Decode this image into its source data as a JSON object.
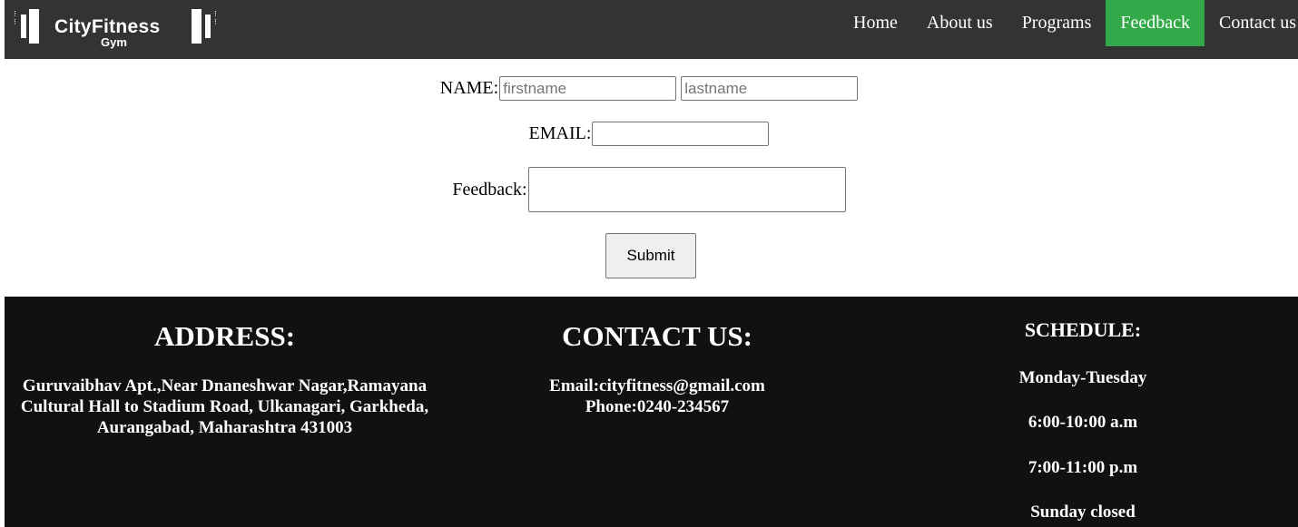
{
  "brand": {
    "name": "CityFitness",
    "tagline": "Gym"
  },
  "nav": {
    "items": [
      {
        "label": "Home"
      },
      {
        "label": "About us"
      },
      {
        "label": "Programs"
      },
      {
        "label": "Feedback",
        "active": true
      },
      {
        "label": "Contact us"
      }
    ]
  },
  "form": {
    "name_label": "NAME:",
    "firstname_placeholder": "firstname",
    "lastname_placeholder": "lastname",
    "email_label": "EMAIL:",
    "feedback_label": "Feedback:",
    "submit_label": "Submit"
  },
  "footer": {
    "address": {
      "heading": "ADDRESS:",
      "lines": [
        "Guruvaibhav Apt.,Near Dnaneshwar Nagar,Ramayana",
        "Cultural Hall to Stadium Road, Ulkanagari, Garkheda,",
        "Aurangabad, Maharashtra 431003"
      ]
    },
    "contact": {
      "heading": "CONTACT US:",
      "email": "Email:cityfitness@gmail.com",
      "phone": "Phone:0240-234567"
    },
    "schedule": {
      "heading": "SCHEDULE:",
      "days": "Monday-Tuesday",
      "morning": "6:00-10:00 a.m",
      "evening": "7:00-11:00 p.m",
      "sunday": "Sunday closed"
    }
  },
  "colors": {
    "nav_bg": "#333333",
    "active": "#33aa4a",
    "footer_bg": "#111111"
  }
}
